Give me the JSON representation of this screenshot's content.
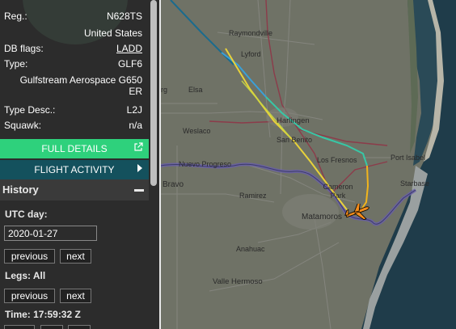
{
  "details": {
    "reg_label": "Reg.:",
    "reg_value": "N628TS",
    "country": "United States",
    "db_flags_label": "DB flags:",
    "db_flags_value": "LADD",
    "type_label": "Type:",
    "type_value": "GLF6",
    "type_full": "Gulfstream Aerospace G650 ER",
    "type_desc_label": "Type Desc.:",
    "type_desc_value": "L2J",
    "squawk_label": "Squawk:",
    "squawk_value": "n/a"
  },
  "buttons": {
    "full_details": "FULL DETAILS",
    "flight_activity": "FLIGHT ACTIVITY"
  },
  "history": {
    "title": "History",
    "utc_day_label": "UTC day:",
    "date_value": "2020-01-27",
    "previous_label": "previous",
    "next_label": "next",
    "legs_label": "Legs: All",
    "time_label": "Time: 17:59:32 Z"
  },
  "map": {
    "places": [
      "Raymondville",
      "Lyford",
      "rg",
      "Elsa",
      "Harlingen",
      "Weslaco",
      "San Benito",
      "Los Fresnos",
      "Port Isabel",
      "Nuevo Progreso",
      "Bravo",
      "Cameron Park",
      "Starbase",
      "Ramirez",
      "Matamoros",
      "Anahuac",
      "Valle Hermoso"
    ]
  },
  "colors": {
    "accent_green": "#2ed17c",
    "activity_teal": "#14515d",
    "aircraft_orange": "#f28c1c"
  }
}
